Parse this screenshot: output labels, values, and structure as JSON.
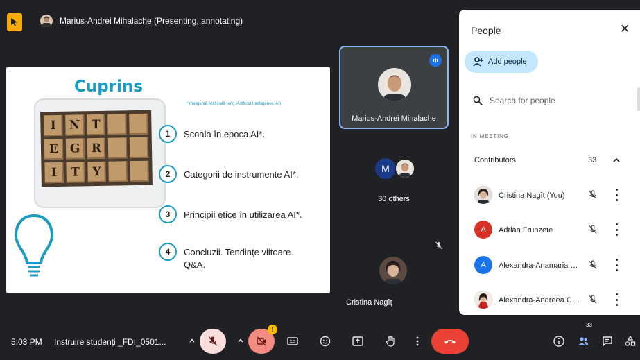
{
  "header": {
    "presenter_status": "Marius-Andrei Mihalache (Presenting, annotating)"
  },
  "slide": {
    "title": "Cuprins",
    "note": "*Inteligență Artificială (eng. Artificial Intelligence, AI)",
    "image_letters": [
      "I",
      "N",
      "T",
      "",
      "",
      "E",
      "G",
      "R",
      "",
      "",
      "I",
      "T",
      "Y",
      "",
      ""
    ],
    "items": [
      {
        "num": "1",
        "text": "Școala în epoca AI*."
      },
      {
        "num": "2",
        "text": "Categorii de instrumente AI*."
      },
      {
        "num": "3",
        "text": "Principii etice în utilizarea AI*."
      },
      {
        "num": "4",
        "text": "Concluzii. Tendințe viitoare. Q&A."
      }
    ]
  },
  "tiles": {
    "main_name": "Marius-Andrei Mihalache",
    "others_initial": "M",
    "others_label": "30 others",
    "self_name": "Cristina Nagîț"
  },
  "panel": {
    "title": "People",
    "add_label": "Add people",
    "search_placeholder": "Search for people",
    "section_label": "IN MEETING",
    "group_label": "Contributors",
    "group_count": "33",
    "people": [
      {
        "name": "Cristina Nagîț (You)",
        "initial": "",
        "color": "#3a2f2a"
      },
      {
        "name": "Adrian Frunzete",
        "initial": "A",
        "color": "#d93025"
      },
      {
        "name": "Alexandra-Anamaria Spi...",
        "initial": "A",
        "color": "#1a73e8"
      },
      {
        "name": "Alexandra-Andreea Co...",
        "initial": "",
        "color": "#6d1f1f"
      }
    ]
  },
  "toolbar": {
    "time": "5:03 PM",
    "meeting_name": "Instruire studenți _FDI_0501...",
    "cam_warning": "!",
    "people_count": "33"
  },
  "colors": {
    "accent_blue": "#8ab4f8",
    "end_call": "#ea4335",
    "mic_off_bg": "#f9dedc",
    "cam_off_bg": "#f28b82",
    "slide_accent": "#1a9bc0"
  }
}
